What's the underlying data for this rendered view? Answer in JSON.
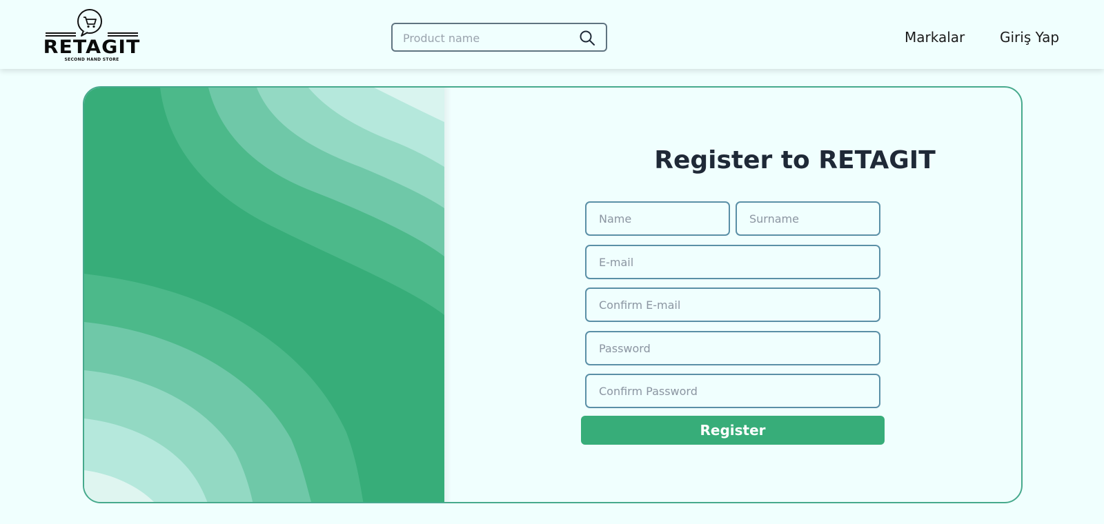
{
  "header": {
    "logo_text": "RETAGIT",
    "logo_subtitle": "SECOND HAND STORE",
    "search_placeholder": "Product name",
    "nav": {
      "brands": "Markalar",
      "login": "Giriş Yap"
    }
  },
  "register": {
    "title": "Register to RETAGIT",
    "fields": {
      "name": "Name",
      "surname": "Surname",
      "email": "E-mail",
      "confirm_email": "Confirm E-mail",
      "password": "Password",
      "confirm_password": "Confirm Password"
    },
    "button": "Register"
  },
  "colors": {
    "background": "#f0fffe",
    "accent": "#37ad79",
    "card_border": "#46a98c",
    "field_border": "#5a8fa6",
    "title_text": "#1f2937"
  },
  "icons": {
    "logo": "shopping-cart-speech-bubble",
    "search": "magnifier"
  }
}
